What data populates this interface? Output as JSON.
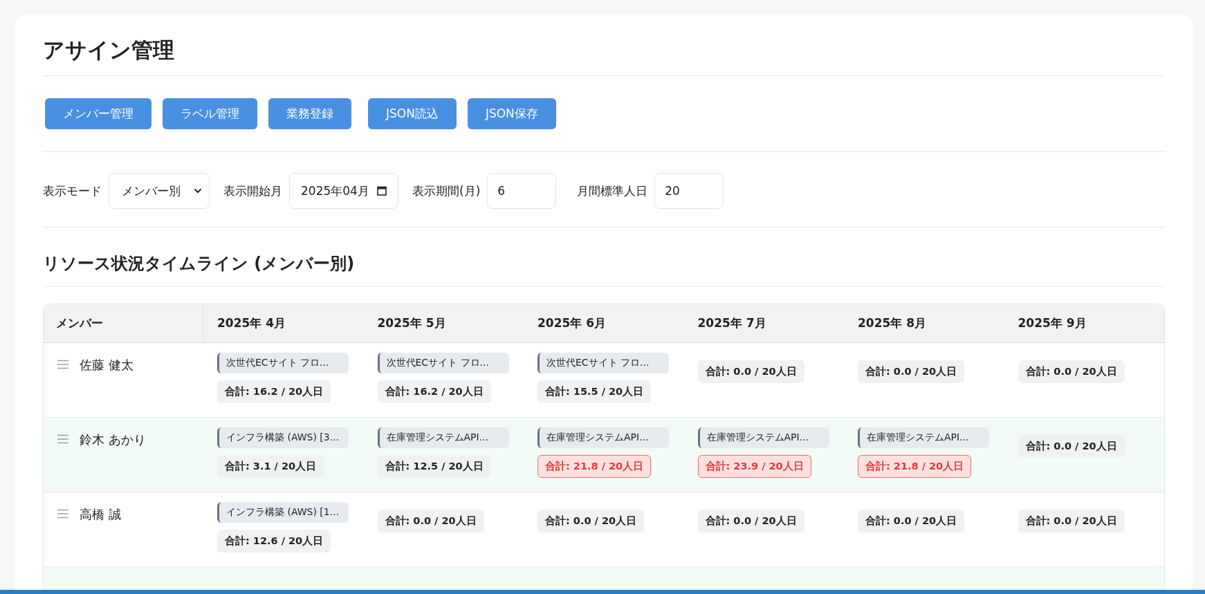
{
  "title": "アサイン管理",
  "buttons": [
    "メンバー管理",
    "ラベル管理",
    "業務登録",
    "JSON読込",
    "JSON保存"
  ],
  "filters": {
    "mode_label": "表示モード",
    "mode_value": "メンバー別",
    "start_label": "表示開始月",
    "start_value": "2025年04月",
    "period_label": "表示期間(月)",
    "period_value": "6",
    "std_label": "月間標準人日",
    "std_value": "20"
  },
  "section_title": "リソース状況タイムライン (メンバー別)",
  "table": {
    "member_header": "メンバー",
    "months": [
      "2025年 4月",
      "2025年 5月",
      "2025年 6月",
      "2025年 7月",
      "2025年 8月",
      "2025年 9月"
    ],
    "rows": [
      {
        "member": "佐藤 健太",
        "cells": [
          {
            "tasks": [
              "次世代ECサイト フロ..."
            ],
            "total": "合計: 16.2 / 20人日",
            "over": false
          },
          {
            "tasks": [
              "次世代ECサイト フロ..."
            ],
            "total": "合計: 16.2 / 20人日",
            "over": false
          },
          {
            "tasks": [
              "次世代ECサイト フロ..."
            ],
            "total": "合計: 15.5 / 20人日",
            "over": false
          },
          {
            "total": "合計: 0.0 / 20人日",
            "over": false
          },
          {
            "total": "合計: 0.0 / 20人日",
            "over": false
          },
          {
            "total": "合計: 0.0 / 20人日",
            "over": false
          }
        ]
      },
      {
        "member": "鈴木 あかり",
        "cells": [
          {
            "tasks": [
              "インフラ構築 (AWS) [3..."
            ],
            "total": "合計: 3.1 / 20人日",
            "over": false
          },
          {
            "tasks": [
              "在庫管理システムAPI..."
            ],
            "total": "合計: 12.5 / 20人日",
            "over": false
          },
          {
            "tasks": [
              "在庫管理システムAPI..."
            ],
            "total": "合計: 21.8 / 20人日",
            "over": true
          },
          {
            "tasks": [
              "在庫管理システムAPI..."
            ],
            "total": "合計: 23.9 / 20人日",
            "over": true
          },
          {
            "tasks": [
              "在庫管理システムAPI..."
            ],
            "total": "合計: 21.8 / 20人日",
            "over": true
          },
          {
            "total": "合計: 0.0 / 20人日",
            "over": false
          }
        ]
      },
      {
        "member": "高橋 誠",
        "cells": [
          {
            "tasks": [
              "インフラ構築 (AWS) [1..."
            ],
            "total": "合計: 12.6 / 20人日",
            "over": false
          },
          {
            "total": "合計: 0.0 / 20人日",
            "over": false
          },
          {
            "total": "合計: 0.0 / 20人日",
            "over": false
          },
          {
            "total": "合計: 0.0 / 20人日",
            "over": false
          },
          {
            "total": "合計: 0.0 / 20人日",
            "over": false
          },
          {
            "total": "合計: 0.0 / 20人日",
            "over": false
          }
        ]
      }
    ]
  }
}
